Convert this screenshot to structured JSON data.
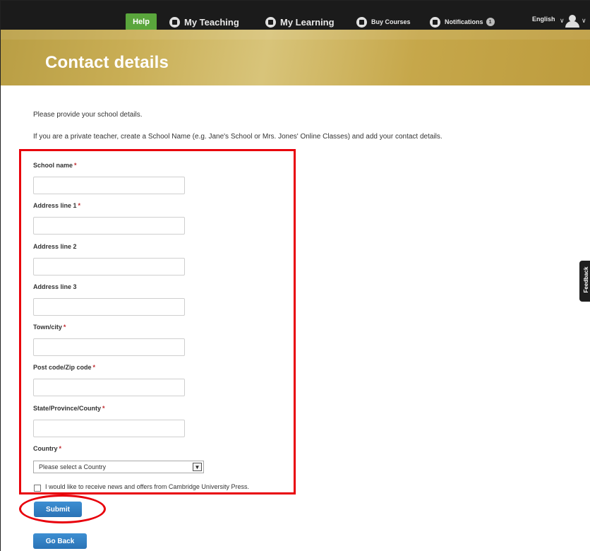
{
  "nav": {
    "help": "Help",
    "my_teaching": "My Teaching",
    "my_learning": "My Learning",
    "buy_courses": "Buy Courses",
    "notifications": "Notifications",
    "notifications_count": "1",
    "language": "English",
    "chevron": "∨"
  },
  "banner": {
    "title": "Contact details"
  },
  "intro": {
    "line1": "Please provide your school details.",
    "line2": "If you are a private teacher, create a School Name (e.g. Jane's School or Mrs. Jones' Online Classes) and add your contact details."
  },
  "form": {
    "required_marker": "*",
    "fields": [
      {
        "label": "School name",
        "required": true,
        "value": ""
      },
      {
        "label": "Address line 1",
        "required": true,
        "value": ""
      },
      {
        "label": "Address line 2",
        "required": false,
        "value": ""
      },
      {
        "label": "Address line 3",
        "required": false,
        "value": ""
      },
      {
        "label": "Town/city",
        "required": true,
        "value": ""
      },
      {
        "label": "Post code/Zip code",
        "required": true,
        "value": ""
      },
      {
        "label": "State/Province/County",
        "required": true,
        "value": ""
      }
    ],
    "country": {
      "label": "Country",
      "required": true,
      "selected": "Please select a Country"
    },
    "newsletter": {
      "label": "I would like to receive news and offers from Cambridge University Press.",
      "checked": false
    },
    "submit_label": "Submit",
    "go_back_label": "Go Back"
  },
  "feedback": {
    "label": "Feedback"
  },
  "colors": {
    "help_button": "#5aa63c",
    "banner_gold": "#c9ae55",
    "primary_button": "#2e7bbf",
    "required": "#c0282d",
    "highlight": "#e8000b"
  }
}
